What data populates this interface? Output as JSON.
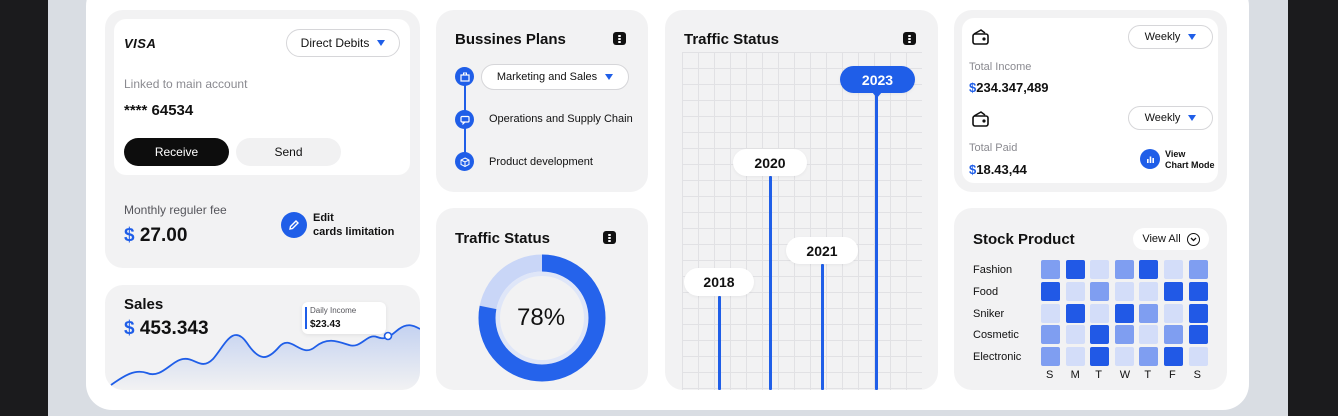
{
  "card": {
    "brand": "VISA",
    "debit_dropdown": "Direct Debits",
    "linked_label": "Linked to main account",
    "number": "**** 64534",
    "receive_label": "Receive",
    "send_label": "Send",
    "fee_label": "Monthly reguler fee",
    "fee_currency": "$",
    "fee_value": "27.00",
    "edit_line1": "Edit",
    "edit_line2": "cards limitation"
  },
  "sales": {
    "title": "Sales",
    "currency": "$",
    "value": "453.343",
    "tooltip_label": "Daily Income",
    "tooltip_value": "$23.43"
  },
  "plans": {
    "title": "Bussines Plans",
    "items": [
      "Marketing and Sales",
      "Operations and Supply Chain",
      "Product development"
    ]
  },
  "traffic_donut": {
    "title": "Traffic Status",
    "percent_label": "78%",
    "percent": 0.78
  },
  "traffic_timeline": {
    "title": "Traffic Status",
    "years": [
      "2018",
      "2020",
      "2021",
      "2023"
    ]
  },
  "income": {
    "period1": "Weekly",
    "total_income_label": "Total Income",
    "total_income_currency": "$",
    "total_income_value": "234.347,489",
    "period2": "Weekly",
    "total_paid_label": "Total Paid",
    "total_paid_currency": "$",
    "total_paid_value": "18.43,44",
    "view_line1": "View",
    "view_line2": "Chart Mode"
  },
  "stock": {
    "title": "Stock Product",
    "view_all": "View All",
    "rows": [
      "Fashion",
      "Food",
      "Sniker",
      "Cosmetic",
      "Electronic"
    ],
    "days": [
      "S",
      "M",
      "T",
      "W",
      "T",
      "F",
      "S"
    ],
    "intensity": [
      [
        2,
        3,
        1,
        2,
        3,
        1,
        2
      ],
      [
        3,
        1,
        2,
        1,
        1,
        3,
        3
      ],
      [
        1,
        3,
        1,
        3,
        2,
        1,
        3
      ],
      [
        2,
        1,
        3,
        2,
        1,
        2,
        3
      ],
      [
        2,
        1,
        3,
        1,
        2,
        3,
        1
      ]
    ],
    "colors": {
      "1": "#d3ddf9",
      "2": "#7f9ef1",
      "3": "#2159e6"
    }
  },
  "colors": {
    "accent": "#1f5ee8",
    "card_bg": "#f2f2f3",
    "dark_button": "#0d0d0d"
  }
}
